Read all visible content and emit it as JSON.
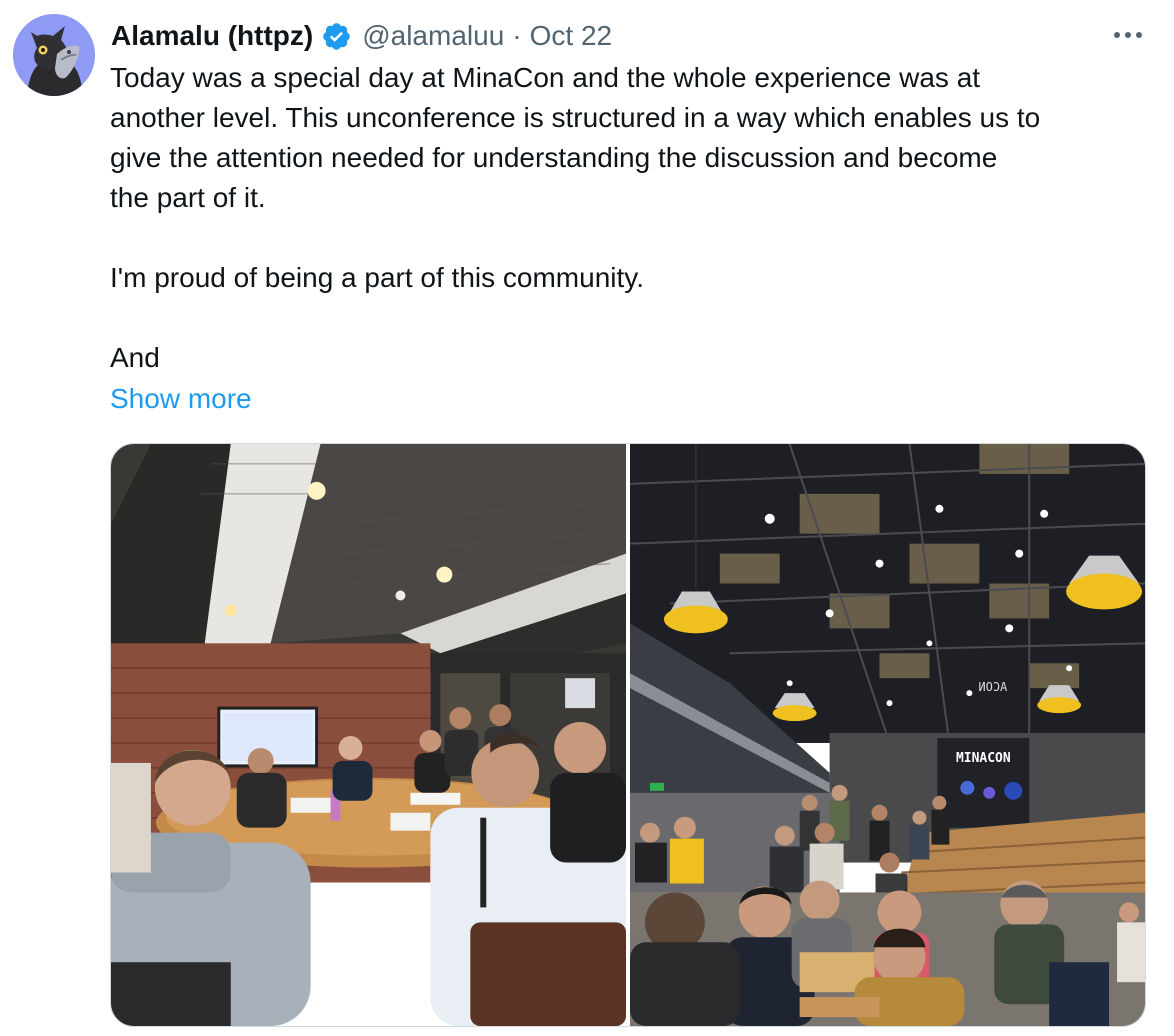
{
  "author": {
    "display_name": "Alamalu (httpz)",
    "handle": "@alamaluu",
    "separator": "·",
    "date": "Oct 22",
    "avatar_icon": "cat-with-bottle-avatar",
    "verified_icon": "verified-badge-icon",
    "verified_color": "#1d9bf0"
  },
  "tweet": {
    "lines": [
      "Today was a special day at MinaCon and the whole experience was at",
      "another level. This unconference is structured in a way which enables us to",
      "give the attention needed for understanding the discussion and become",
      "the part of it.",
      "I'm proud of being a part of this community.",
      "And"
    ],
    "show_more_label": "Show more",
    "link_color": "#1d9bf0"
  },
  "menu": {
    "icon": "more-horizontal-icon"
  },
  "media": {
    "photos": [
      {
        "icon": "photo-meeting-room",
        "screen_text": ""
      },
      {
        "icon": "photo-minacon-hall",
        "sign_text": "MINACON",
        "ceiling_text": "ACON"
      }
    ]
  }
}
